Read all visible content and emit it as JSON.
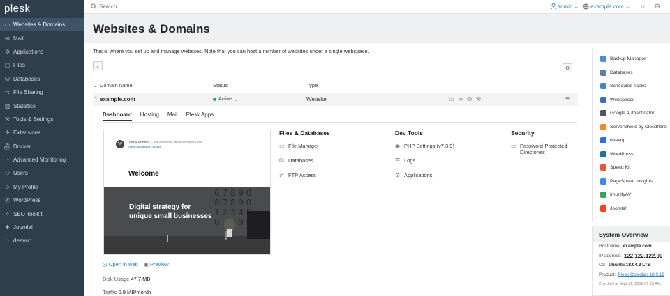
{
  "app": {
    "logo": "plesk"
  },
  "sidebar": {
    "items": [
      {
        "label": "Websites & Domains",
        "icon": "monitor-icon",
        "active": true
      },
      {
        "label": "Mail",
        "icon": "mail-icon"
      },
      {
        "label": "Applications",
        "icon": "apps-icon"
      },
      {
        "label": "Files",
        "icon": "folder-icon"
      },
      {
        "label": "Databases",
        "icon": "database-icon"
      },
      {
        "label": "File Sharing",
        "icon": "share-icon"
      },
      {
        "label": "Statistics",
        "icon": "stats-icon"
      },
      {
        "label": "Tools & Settings",
        "icon": "tools-icon"
      },
      {
        "label": "Extensions",
        "icon": "extensions-icon"
      },
      {
        "label": "Docker",
        "icon": "docker-icon"
      },
      {
        "label": "Advanced Monitoring",
        "icon": "monitoring-icon"
      },
      {
        "label": "Users",
        "icon": "user-icon"
      },
      {
        "label": "My Profile",
        "icon": "profile-icon"
      },
      {
        "label": "WordPress",
        "icon": "wordpress-icon"
      },
      {
        "label": "SEO Toolkit",
        "icon": "seo-icon"
      },
      {
        "label": "Joomla!",
        "icon": "joomla-icon"
      },
      {
        "label": "deevop",
        "icon": "deevop-icon"
      }
    ]
  },
  "topbar": {
    "search_placeholder": "Search...",
    "user": "admin",
    "domain": "example.com"
  },
  "page": {
    "title": "Websites & Domains",
    "intro": "This is where you set up and manage websites. Note that you can host a number of websites under a single webspace."
  },
  "table": {
    "headers": {
      "domain": "Domain name",
      "status": "Status",
      "type": "Type"
    },
    "row": {
      "domain": "example.com",
      "status": "Active",
      "type": "Website"
    }
  },
  "tabs": [
    "Dashboard",
    "Hosting",
    "Mail",
    "Plesk Apps"
  ],
  "preview": {
    "site_title": "Twenty Nineteen",
    "site_tagline": "— The WordPress default theme for 2019",
    "nav": "Home  About  Blog  Contact",
    "welcome": "Welcome",
    "hero_line1": "Digital strategy for",
    "hero_line2": "unique small businesses"
  },
  "below_preview": {
    "open_in_web": "Open in web",
    "preview": "Preview",
    "disk_usage_label": "Disk Usage",
    "disk_usage_value": "47.7 MB",
    "traffic_label": "Traffic",
    "traffic_value": "0.9 MB/month"
  },
  "columns": {
    "files_db": {
      "title": "Files & Databases",
      "links": [
        "File Manager",
        "Databases",
        "FTP Access"
      ]
    },
    "dev_tools": {
      "title": "Dev Tools",
      "links": [
        "PHP Settings (v7.3.9)",
        "Logs",
        "Applications"
      ]
    },
    "security": {
      "title": "Security",
      "link_line1": "Password-Protected",
      "link_line2": "Directories"
    }
  },
  "right_panel": {
    "items": [
      {
        "label": "Backup Manager",
        "color": "#4a8fd1"
      },
      {
        "label": "Databases",
        "color": "#5a7fa8"
      },
      {
        "label": "Scheduled Tasks",
        "color": "#3f87c9"
      },
      {
        "label": "Webspaces",
        "color": "#3b6fb2"
      },
      {
        "label": "Google Authenticator",
        "color": "#555555"
      },
      {
        "label": "ServerShield by Cloudflare",
        "color": "#f08a24"
      },
      {
        "label": "deevop",
        "color": "#2f6fd6"
      },
      {
        "label": "WordPress",
        "color": "#21759b"
      },
      {
        "label": "Speed Kit",
        "color": "#e05a3c"
      },
      {
        "label": "PageSpeed Insights",
        "color": "#4285f4"
      },
      {
        "label": "ImunifyAV",
        "color": "#3aa35b"
      },
      {
        "label": "Joomla!",
        "color": "#f44321"
      }
    ]
  },
  "system_overview": {
    "title": "System Overview",
    "hostname_label": "Hostname:",
    "hostname": "example.com",
    "ip_label": "IP address:",
    "ip": "122.122.122.00",
    "os_label": "OS:",
    "os": "Ubuntu 18.04.3 LTS",
    "product_label": "Product:",
    "product": "Plesk Obsidian 18.0.19",
    "checked": "Checked at Sept 21, 2019 06:25 AM."
  },
  "colors": {
    "sidebar_bg": "#2f3e4d",
    "accent": "#2a82c6",
    "active_green": "#3aa35b"
  }
}
